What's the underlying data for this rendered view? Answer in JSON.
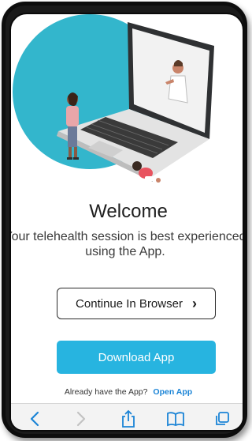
{
  "welcome": {
    "title": "Welcome",
    "subtitle_line1": "Your telehealth session is best experienced",
    "subtitle_line2": "using the App."
  },
  "buttons": {
    "continue_browser": "Continue In Browser",
    "continue_chevron": "›",
    "download_app": "Download App"
  },
  "footer": {
    "already_text": "Already have the App?",
    "open_app": "Open App"
  },
  "toolbar": {
    "icons": [
      "back-icon",
      "forward-icon",
      "share-icon",
      "bookmarks-icon",
      "tabs-icon"
    ]
  },
  "colors": {
    "accent": "#27b4e0",
    "link": "#1b84d6",
    "illustration_circle": "#33b6cc"
  }
}
